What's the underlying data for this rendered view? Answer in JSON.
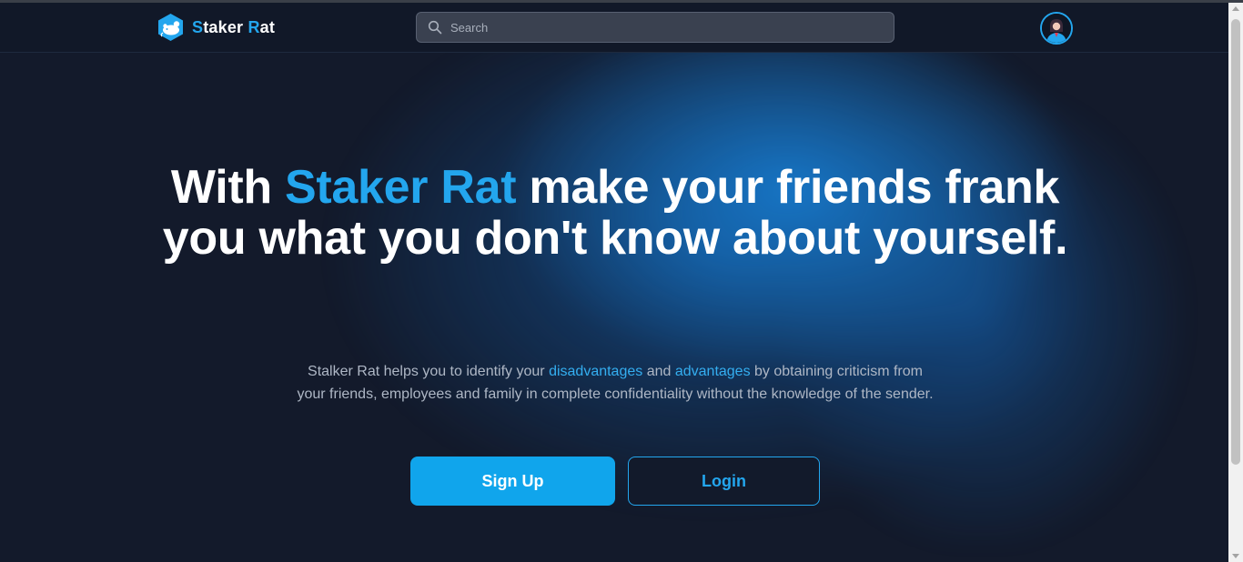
{
  "colors": {
    "background": "#131a2b",
    "navbar": "#111828",
    "accent": "#23a6ee",
    "primary_button": "#10a5ec",
    "muted_text": "#aeb7c5"
  },
  "navbar": {
    "logo": {
      "icon": "rat-logo-icon",
      "first_letter": "S",
      "first_rest": "taker ",
      "second_letter": "R",
      "second_rest": "at"
    },
    "search": {
      "icon": "search-icon",
      "placeholder": "Search",
      "value": ""
    },
    "avatar": {
      "icon": "user-avatar-icon"
    }
  },
  "hero": {
    "headline": {
      "before": "With ",
      "brand": "Staker Rat",
      "after": " make your friends frank you what you don't know about yourself."
    },
    "description": {
      "part1": "Stalker Rat helps you to identify your ",
      "highlight1": "disadvantages",
      "part2": " and ",
      "highlight2": "advantages",
      "part3": " by obtaining criticism from your friends, employees and family in complete confidentiality without the knowledge of the sender."
    },
    "buttons": {
      "signup": "Sign Up",
      "login": "Login"
    }
  }
}
